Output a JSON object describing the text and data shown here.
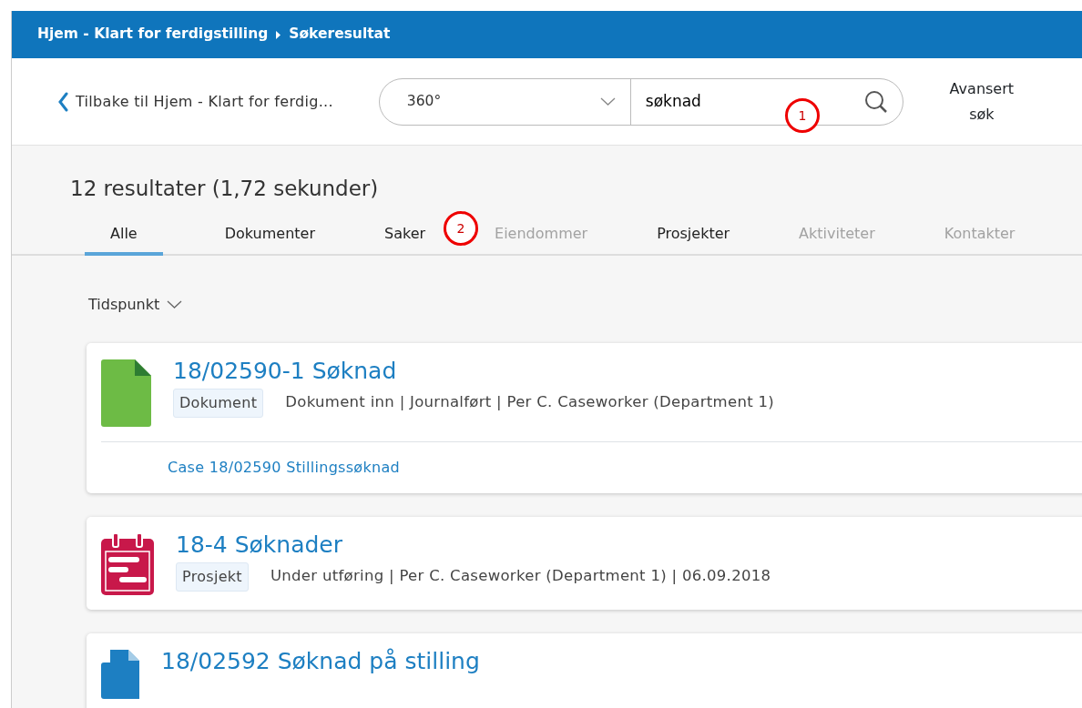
{
  "breadcrumb": [
    "Hjem - Klart for ferdigstilling",
    "Søkeresultat"
  ],
  "back_link": "Tilbake til Hjem - Klart for ferdig...",
  "search": {
    "scope": "360°",
    "value": "søknad"
  },
  "advanced_search": "Avansert søk",
  "annotations": [
    "1",
    "2"
  ],
  "summary": "12 resultater (1,72 sekunder)",
  "tabs": [
    {
      "label": "Alle",
      "selected": true,
      "disabled": false
    },
    {
      "label": "Dokumenter",
      "selected": false,
      "disabled": false
    },
    {
      "label": "Saker",
      "selected": false,
      "disabled": false
    },
    {
      "label": "Eiendommer",
      "selected": false,
      "disabled": true
    },
    {
      "label": "Prosjekter",
      "selected": false,
      "disabled": false
    },
    {
      "label": "Aktiviteter",
      "selected": false,
      "disabled": true
    },
    {
      "label": "Kontakter",
      "selected": false,
      "disabled": true
    }
  ],
  "sort": "Tidspunkt",
  "results": [
    {
      "kind": "document",
      "title": "18/02590-1 Søknad",
      "tag": "Dokument",
      "meta": "Dokument inn | Journalført | Per C. Caseworker (Department 1)",
      "link": "Case 18/02590 Stillingssøknad"
    },
    {
      "kind": "project",
      "title": "18-4 Søknader",
      "tag": "Prosjekt",
      "meta": "Under utføring | Per C. Caseworker (Department 1) | 06.09.2018"
    },
    {
      "kind": "case",
      "title": "18/02592 Søknad på stilling"
    }
  ]
}
